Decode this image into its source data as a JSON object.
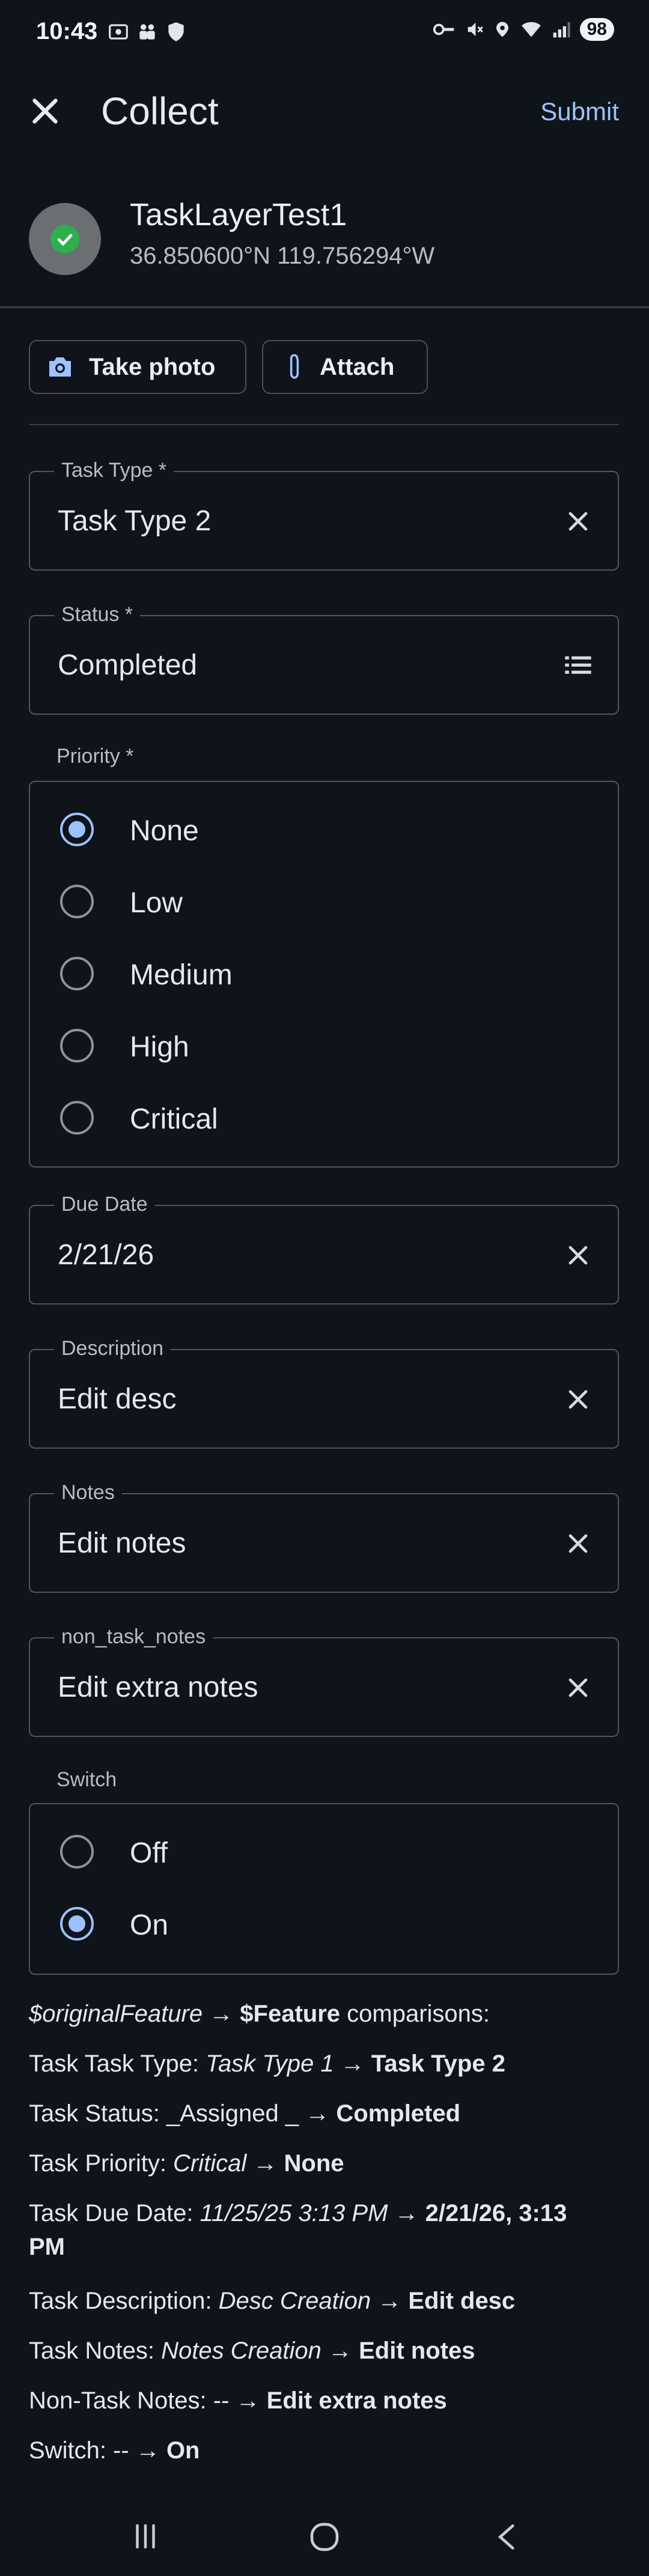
{
  "status_bar": {
    "time": "10:43",
    "battery": "98",
    "icons": [
      "screenshot-icon",
      "shield-icon",
      "vpn-key-icon",
      "mute-icon",
      "location-icon",
      "wifi-icon",
      "signal-icon"
    ]
  },
  "header": {
    "title": "Collect",
    "submit_label": "Submit"
  },
  "feature": {
    "name": "TaskLayerTest1",
    "coords": "36.850600°N  119.756294°W"
  },
  "actions": {
    "take_photo": "Take photo",
    "attach": "Attach"
  },
  "fields": {
    "task_type": {
      "label": "Task Type *",
      "value": "Task Type 2"
    },
    "status": {
      "label": "Status *",
      "value": "Completed"
    },
    "due_date": {
      "label": "Due Date",
      "value": "2/21/26"
    },
    "description": {
      "label": "Description",
      "value": "Edit desc"
    },
    "notes": {
      "label": "Notes",
      "value": "Edit notes"
    },
    "non_task_notes": {
      "label": "non_task_notes",
      "value": "Edit extra notes"
    }
  },
  "priority": {
    "label": "Priority *",
    "options": [
      "None",
      "Low",
      "Medium",
      "High",
      "Critical"
    ],
    "selected": "None"
  },
  "switch": {
    "label": "Switch",
    "options": [
      "Off",
      "On"
    ],
    "selected": "On"
  },
  "comparisons": {
    "heading_var1": "$originalFeature",
    "heading_arrow": " → ",
    "heading_var2": "$Feature",
    "heading_rest": " comparisons:",
    "rows": [
      {
        "prefix": "Task Task Type: ",
        "old": "Task Type 1",
        "arrow": " → ",
        "new": "Task Type 2"
      },
      {
        "prefix": "Task Status: ",
        "old": "_Assigned _",
        "arrow": " → ",
        "new": "Completed"
      },
      {
        "prefix": "Task Priority: ",
        "old": "Critical",
        "arrow": " → ",
        "new": "None"
      },
      {
        "prefix": "Task Due Date: ",
        "old": "11/25/25 3:13 PM",
        "arrow": " → ",
        "new": "2/21/26, 3:13 PM"
      },
      {
        "prefix": "Task Description: ",
        "old": "Desc Creation",
        "arrow": " → ",
        "new": "Edit desc"
      },
      {
        "prefix": "Task Notes: ",
        "old": "Notes Creation",
        "arrow": " → ",
        "new": "Edit notes"
      },
      {
        "prefix": "Non-Task Notes: ",
        "old": "-- ",
        "arrow": "→ ",
        "new": "Edit extra notes"
      },
      {
        "prefix": "Switch: ",
        "old": "--  ",
        "arrow": "→ ",
        "new": "On"
      }
    ]
  },
  "colors": {
    "background": "#0f131a",
    "accent": "#9cc3ff",
    "success": "#2fae4c"
  }
}
